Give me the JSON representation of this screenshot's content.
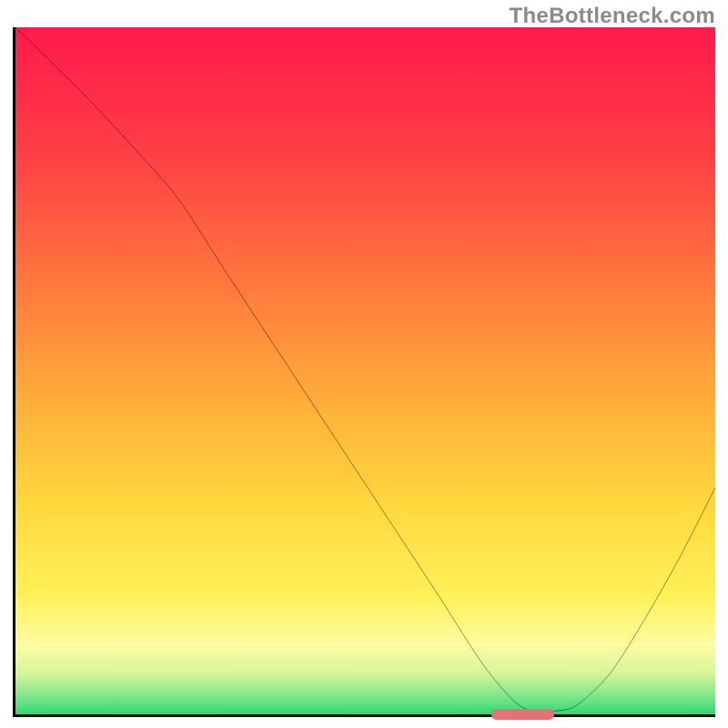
{
  "watermark": "TheBottleneck.com",
  "colors": {
    "axis": "#000000",
    "curve": "#000000",
    "marker": "#e57373",
    "gradient_stops": [
      {
        "pct": 0,
        "color": "#ff1a4b"
      },
      {
        "pct": 18,
        "color": "#ff3e46"
      },
      {
        "pct": 38,
        "color": "#ff7a3c"
      },
      {
        "pct": 56,
        "color": "#ffb23a"
      },
      {
        "pct": 70,
        "color": "#ffd93d"
      },
      {
        "pct": 83,
        "color": "#fff15a"
      },
      {
        "pct": 90,
        "color": "#fdfca2"
      },
      {
        "pct": 94,
        "color": "#d7f59a"
      },
      {
        "pct": 97,
        "color": "#89e88d"
      },
      {
        "pct": 100,
        "color": "#2fd873"
      }
    ]
  },
  "chart_data": {
    "type": "line",
    "title": "",
    "xlabel": "",
    "ylabel": "",
    "xlim": [
      0,
      100
    ],
    "ylim": [
      0,
      100
    ],
    "x": [
      0,
      10,
      20,
      24,
      30,
      40,
      50,
      60,
      67,
      72,
      76,
      80,
      85,
      90,
      95,
      100
    ],
    "y": [
      100,
      90,
      79,
      74,
      64.5,
      49,
      33.5,
      18,
      7,
      1.3,
      0.5,
      1.2,
      6,
      14,
      23,
      33
    ],
    "optimum_x_range": [
      68,
      77
    ],
    "annotations": [
      "TheBottleneck.com"
    ]
  }
}
